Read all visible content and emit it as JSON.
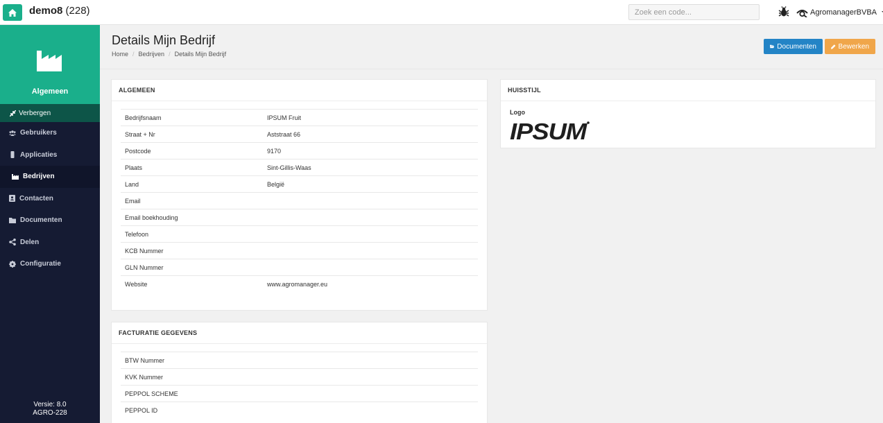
{
  "topbar": {
    "app_name": "demo8",
    "app_count": "(228)",
    "search_placeholder": "Zoek een code...",
    "user_name": "AgromanagerBVBA"
  },
  "sidebar": {
    "title": "Algemeen",
    "toggle_label": "Verbergen",
    "items": [
      {
        "label": "Gebruikers",
        "icon": "users-icon"
      },
      {
        "label": "Applicaties",
        "icon": "mobile-icon"
      },
      {
        "label": "Bedrijven",
        "icon": "factory-icon",
        "active": true
      },
      {
        "label": "Contacten",
        "icon": "contact-book-icon"
      },
      {
        "label": "Documenten",
        "icon": "folder-icon"
      },
      {
        "label": "Delen",
        "icon": "share-icon"
      },
      {
        "label": "Configuratie",
        "icon": "gear-icon"
      }
    ],
    "version": "Versie: 8.0",
    "build": "AGRO-228"
  },
  "page": {
    "title": "Details Mijn Bedrijf",
    "breadcrumb": [
      "Home",
      "Bedrijven",
      "Details Mijn Bedrijf"
    ],
    "btn_documents": "Documenten",
    "btn_edit": "Bewerken"
  },
  "algemeen": {
    "title": "ALGEMEEN",
    "rows": [
      {
        "label": "Bedrijfsnaam",
        "value": "IPSUM Fruit"
      },
      {
        "label": "Straat + Nr",
        "value": "Aststraat 66"
      },
      {
        "label": "Postcode",
        "value": "9170"
      },
      {
        "label": "Plaats",
        "value": "Sint-Gillis-Waas"
      },
      {
        "label": "Land",
        "value": "België"
      },
      {
        "label": "Email",
        "value": ""
      },
      {
        "label": "Email boekhouding",
        "value": ""
      },
      {
        "label": "Telefoon",
        "value": ""
      },
      {
        "label": "KCB Nummer",
        "value": ""
      },
      {
        "label": "GLN Nummer",
        "value": ""
      },
      {
        "label": "Website",
        "value": "www.agromanager.eu"
      }
    ]
  },
  "facturatie": {
    "title": "FACTURATIE GEGEVENS",
    "rows": [
      {
        "label": "BTW Nummer",
        "value": ""
      },
      {
        "label": "KVK Nummer",
        "value": ""
      },
      {
        "label": "PEPPOL SCHEME",
        "value": ""
      },
      {
        "label": "PEPPOL ID",
        "value": ""
      }
    ]
  },
  "huisstijl": {
    "title": "HUISSTIJL",
    "logo_label": "Logo",
    "logo_text": "IPSUM"
  },
  "colors": {
    "brand": "#1aaf8b",
    "sidebar": "#151b33",
    "primary_button": "#2384c6",
    "warning_button": "#f0a64a"
  }
}
